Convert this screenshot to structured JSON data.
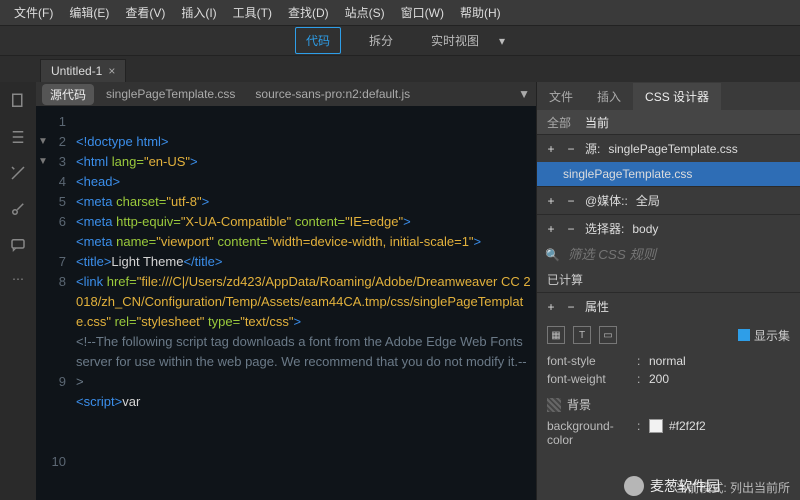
{
  "menu": [
    "文件(F)",
    "编辑(E)",
    "查看(V)",
    "插入(I)",
    "工具(T)",
    "查找(D)",
    "站点(S)",
    "窗口(W)",
    "帮助(H)"
  ],
  "viewmodes": {
    "code": "代码",
    "split": "拆分",
    "live": "实时视图"
  },
  "tab": {
    "title": "Untitled-1",
    "close": "×"
  },
  "filebar": {
    "source": "源代码",
    "f1": "singlePageTemplate.css",
    "f2": "source-sans-pro:n2:default.js"
  },
  "gutter": [
    "1",
    "2",
    "3",
    "4",
    "5",
    "6",
    "7",
    "8",
    "9",
    "10"
  ],
  "panel": {
    "tabs": {
      "files": "文件",
      "insert": "插入",
      "css": "CSS 设计器"
    },
    "subtabs": {
      "all": "全部",
      "current": "当前"
    },
    "source_label": "源:",
    "source_val": "singlePageTemplate.css",
    "selected": "singlePageTemplate.css",
    "media_label": "@媒体::",
    "media_val": "全局",
    "selector_label": "选择器:",
    "selector_val": "body",
    "filter_placeholder": "筛选 CSS 规则",
    "computed": "已计算",
    "props": "属性",
    "showset": "显示集",
    "prop_rows": [
      {
        "k": "font-style",
        "v": "normal"
      },
      {
        "k": "font-weight",
        "v": "200"
      }
    ],
    "bg_label": "背景",
    "bgprop": "background-color",
    "bgval": "#f2f2f2"
  },
  "status": "当前模式: 列出当前所",
  "watermark": "麦葱软件园"
}
